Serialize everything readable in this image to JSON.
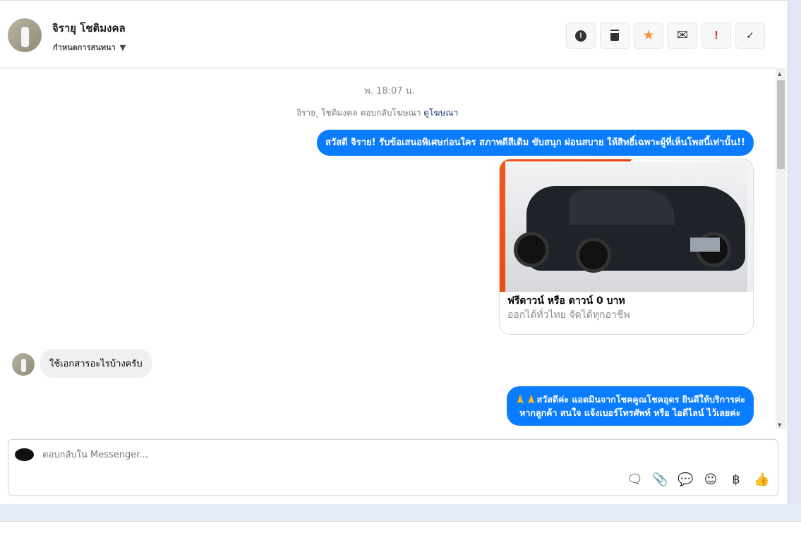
{
  "header": {
    "contact_name": "จิรายุ โชติมงคล",
    "conversation_menu": "กำหนดการสนทนา",
    "toolbar": [
      {
        "icon": "alert-circle-icon",
        "glyph": "⬤"
      },
      {
        "icon": "trash-icon",
        "glyph": "🗑"
      },
      {
        "icon": "star-icon",
        "glyph": "★",
        "color": "#f5923e"
      },
      {
        "icon": "envelope-icon",
        "glyph": "✉"
      },
      {
        "icon": "exclamation-icon",
        "glyph": "!",
        "color": "#e02424"
      },
      {
        "icon": "check-icon",
        "glyph": "✓"
      }
    ]
  },
  "thread": {
    "timestamp": "พ. 18:07 น.",
    "ad_reply_text": "จิราย ุ โชติมงคล ตอบกลับโฆษณา",
    "ad_link": "ดูโฆษณา",
    "messages": [
      {
        "from": "page",
        "text": "สวัสดี จิราย! รับข้อเสนอพิเศษก่อนใคร สภาพดีสีเดิม ขับสนุก ผ่อนสบาย ให้สิทธิ์เฉพาะผู้ที่เห็นโพสนี้เท่านั้น!!"
      },
      {
        "from": "page",
        "type": "card",
        "title": "ฟรีดาวน์ หรือ ดาวน์ 0 บาท",
        "subtitle": "ออกได้ทั่วไทย จัดได้ทุกอาชีพ"
      },
      {
        "from": "user",
        "text": "ใช้เอกสารอะไรบ้างครับ"
      },
      {
        "from": "page",
        "line1": "🙏🙏สวัสดีค่ะ แอดมินจากโชคคูณโชคอุดร ยินดีให้บริการค่ะ",
        "line2": "หากลูกค้า สนใจ แจ้งเบอร์โทรศัพท์ หรือ ไอดีไลน์  ไว้เลยค่ะ"
      }
    ]
  },
  "composer": {
    "placeholder": "ตอบกลับใน Messenger...",
    "value": "",
    "tools": [
      {
        "icon": "saved-reply-icon",
        "glyph": "🗨"
      },
      {
        "icon": "attachment-icon",
        "glyph": "📎"
      },
      {
        "icon": "quick-reply-icon",
        "glyph": "💬"
      },
      {
        "icon": "emoji-icon",
        "glyph": "☺"
      },
      {
        "icon": "baht-icon",
        "glyph": "฿"
      },
      {
        "icon": "thumbs-up-icon",
        "glyph": "👍"
      }
    ]
  },
  "colors": {
    "bubble": "#0a7cff",
    "accent_star": "#f5923e",
    "alert_red": "#e02424"
  }
}
